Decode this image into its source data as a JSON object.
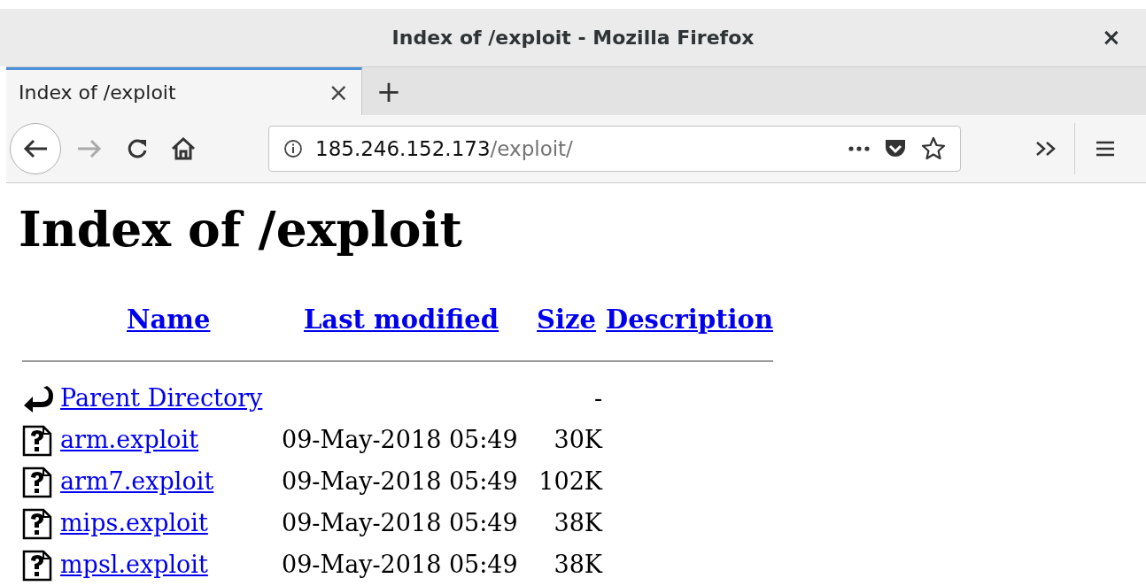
{
  "window": {
    "title": "Index of /exploit - Mozilla Firefox",
    "close": "×"
  },
  "tabs": [
    {
      "label": "Index of /exploit",
      "selected": true,
      "close": "×"
    }
  ],
  "new_tab": "+",
  "address_bar": {
    "host": "185.246.152.173",
    "path": "/exploit/"
  },
  "page": {
    "heading": "Index of /exploit",
    "columns": [
      "Name",
      "Last modified",
      "Size",
      "Description"
    ],
    "rows": [
      {
        "kind": "parent",
        "name": "Parent Directory",
        "modified": "",
        "size": "-"
      },
      {
        "kind": "file",
        "name": "arm.exploit",
        "modified": "09-May-2018 05:49",
        "size": "30K"
      },
      {
        "kind": "file",
        "name": "arm7.exploit",
        "modified": "09-May-2018 05:49",
        "size": "102K"
      },
      {
        "kind": "file",
        "name": "mips.exploit",
        "modified": "09-May-2018 05:49",
        "size": "38K"
      },
      {
        "kind": "file",
        "name": "mpsl.exploit",
        "modified": "09-May-2018 05:49",
        "size": "38K"
      }
    ]
  }
}
